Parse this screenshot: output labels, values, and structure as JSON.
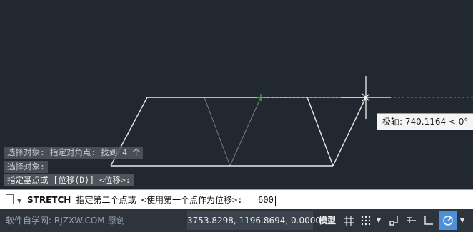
{
  "history": [
    "选择对象: 指定对角点: 找到 4 个",
    "选择对象:",
    "指定基点或 [位移(D)] <位移>:"
  ],
  "tooltip": "极轴: 740.1164 < 0°",
  "command_line": {
    "command": "STRETCH",
    "prompt": "指定第二个点或 <使用第一个点作为位移>:",
    "input": "600"
  },
  "statusbar": {
    "watermark": "软件自学网: RJZXW.COM-原创",
    "coordinates": "3753.8298, 1196.8694, 0.0000",
    "model_label": "模型"
  },
  "colors": {
    "canvas_bg": "#212830",
    "polar_track": "#2fbf2f",
    "geometry": "#e8e8e8",
    "active_button": "#4d8fd8"
  },
  "icons": [
    "doc-icon",
    "grid-icon",
    "snap-icon",
    "ortho-icon",
    "polar-icon",
    "osnap-icon",
    "tracking-icon"
  ]
}
